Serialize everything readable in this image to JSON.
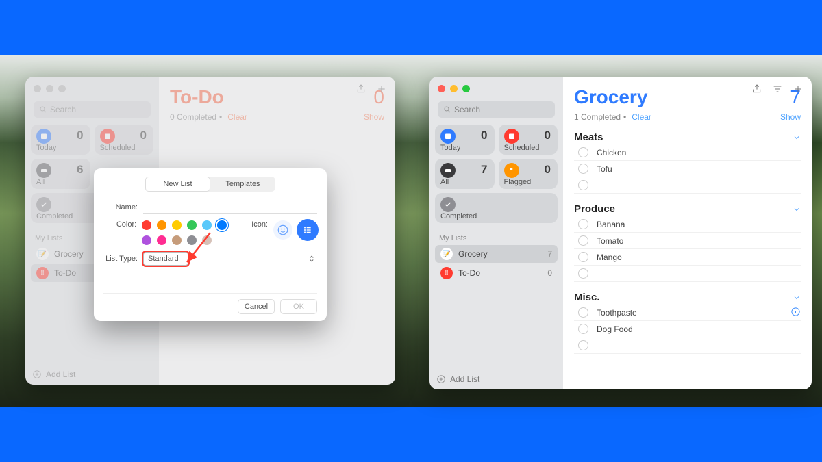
{
  "left": {
    "sidebar": {
      "search_placeholder": "Search",
      "tiles": [
        {
          "key": "today",
          "label": "Today",
          "count": "0",
          "color": "#2f7bff"
        },
        {
          "key": "scheduled",
          "label": "Scheduled",
          "count": "0",
          "color": "#ff3b30"
        },
        {
          "key": "all",
          "label": "All",
          "count": "6",
          "color": "#5b5b60"
        }
      ],
      "completed_label": "Completed",
      "my_lists_label": "My Lists",
      "lists": [
        {
          "name": "Grocery",
          "icon": "📝",
          "count": ""
        },
        {
          "name": "To-Do",
          "icon": "‼️",
          "count": ""
        }
      ],
      "add_list_label": "Add List"
    },
    "main": {
      "title": "To-Do",
      "count": "0",
      "completed_text": "0 Completed",
      "clear": "Clear",
      "show": "Show"
    }
  },
  "dialog": {
    "tabs": [
      "New List",
      "Templates"
    ],
    "name_label": "Name:",
    "color_label": "Color:",
    "icon_label": "Icon:",
    "listtype_label": "List Type:",
    "listtype_value": "Standard",
    "swatches": [
      "#ff3b30",
      "#ff9500",
      "#ffcc00",
      "#34c759",
      "#5ac8fa",
      "#007aff",
      "#af52de",
      "#ff2d92",
      "#c69c7b",
      "#8e8e93",
      "#d6c1b8"
    ],
    "cancel": "Cancel",
    "ok": "OK"
  },
  "right": {
    "sidebar": {
      "search_placeholder": "Search",
      "tiles": [
        {
          "key": "today",
          "label": "Today",
          "count": "0",
          "color": "#2f7bff"
        },
        {
          "key": "scheduled",
          "label": "Scheduled",
          "count": "0",
          "color": "#ff3b30"
        },
        {
          "key": "all",
          "label": "All",
          "count": "7",
          "color": "#3a3a3c"
        },
        {
          "key": "flagged",
          "label": "Flagged",
          "count": "0",
          "color": "#ff9500"
        }
      ],
      "completed_label": "Completed",
      "my_lists_label": "My Lists",
      "lists": [
        {
          "name": "Grocery",
          "icon": "📝",
          "count": "7",
          "selected": true
        },
        {
          "name": "To-Do",
          "icon": "‼️",
          "count": "0"
        }
      ],
      "add_list_label": "Add List"
    },
    "main": {
      "title": "Grocery",
      "count": "7",
      "completed_text": "1 Completed",
      "clear": "Clear",
      "show": "Show",
      "sections": [
        {
          "name": "Meats",
          "items": [
            "Chicken",
            "Tofu",
            ""
          ]
        },
        {
          "name": "Produce",
          "items": [
            "Banana",
            "Tomato",
            "Mango",
            ""
          ]
        },
        {
          "name": "Misc.",
          "items": [
            "Toothpaste",
            "Dog Food",
            ""
          ],
          "info_on": 0
        }
      ]
    }
  }
}
